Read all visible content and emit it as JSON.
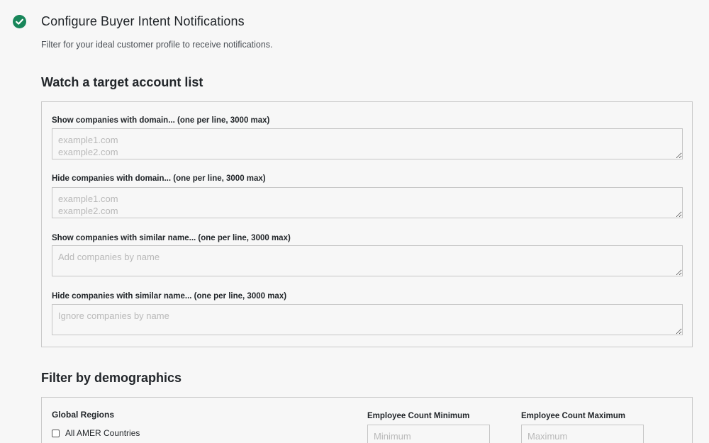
{
  "header": {
    "title": "Configure Buyer Intent Notifications",
    "subtitle": "Filter for your ideal customer profile to receive notifications.",
    "status_icon": "check-circle-icon",
    "accent_color": "#18865a"
  },
  "target_accounts": {
    "title": "Watch a target account list",
    "fields": [
      {
        "label": "Show companies with domain... (one per line, 3000 max)",
        "placeholder": "example1.com\nexample2.com",
        "value": ""
      },
      {
        "label": "Hide companies with domain... (one per line, 3000 max)",
        "placeholder": "example1.com\nexample2.com",
        "value": ""
      },
      {
        "label": "Show companies with similar name... (one per line, 3000 max)",
        "placeholder": "Add companies by name",
        "value": ""
      },
      {
        "label": "Hide companies with similar name... (one per line, 3000 max)",
        "placeholder": "Ignore companies by name",
        "value": ""
      }
    ]
  },
  "demographics": {
    "title": "Filter by demographics",
    "regions_label": "Global Regions",
    "regions": [
      {
        "label": "All AMER Countries",
        "checked": false
      }
    ],
    "employee_min": {
      "label": "Employee Count Minimum",
      "placeholder": "Minimum",
      "value": ""
    },
    "employee_max": {
      "label": "Employee Count Maximum",
      "placeholder": "Maximum",
      "value": ""
    }
  }
}
